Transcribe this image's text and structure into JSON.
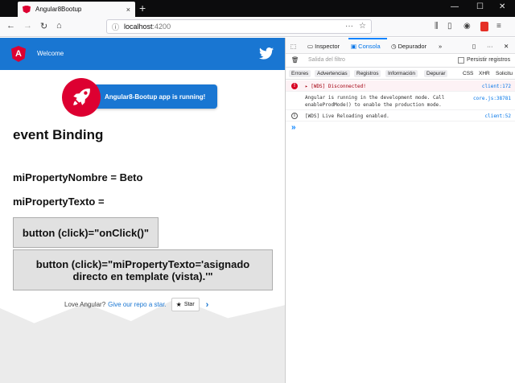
{
  "browser": {
    "tab_title": "Angular8Bootup",
    "tab_close": "×",
    "new_tab": "+",
    "url_host": "localhost",
    "url_port": ":4200",
    "window_controls": {
      "minimize": "—",
      "maximize": "☐",
      "close": "✕"
    }
  },
  "page": {
    "header": {
      "welcome": "Welcome",
      "logo_letter": "A"
    },
    "running_card": "Angular8-Bootup app is running!",
    "section_title": "event Binding",
    "prop1": "miPropertyNombre = Beto",
    "prop2": "miPropertyTexto =",
    "button1": "button (click)=\"onClick()\"",
    "button2": "button (click)=\"miPropertyTexto='asignado directo en template (vista).'\"",
    "footer": {
      "love_text": "Love Angular?",
      "link_text": "Give our repo a star.",
      "star_button": "Star"
    }
  },
  "devtools": {
    "tabs": {
      "inspector": "Inspector",
      "console": "Consola",
      "debugger": "Depurador"
    },
    "filter_placeholder": "Salida del filtro",
    "persist_logs": "Persistir registros",
    "categories": [
      "Errores",
      "Advertencias",
      "Registros",
      "Información",
      "Depurar",
      "CSS",
      "XHR",
      "Solicitu"
    ],
    "logs": [
      {
        "type": "error",
        "message": "▸ [WDS] Disconnected!",
        "source": "client:172"
      },
      {
        "type": "log",
        "message_line1": "Angular is running in the development mode. Call",
        "message_line2": "enableProdMode() to enable the production mode.",
        "source": "core.js:38781"
      },
      {
        "type": "info",
        "message": "[WDS] Live Reloading enabled.",
        "source": "client:52"
      }
    ],
    "prompt": "»"
  },
  "colors": {
    "angular_red": "#dd0031",
    "header_blue": "#1976d2",
    "devtools_accent": "#0a84ff"
  }
}
